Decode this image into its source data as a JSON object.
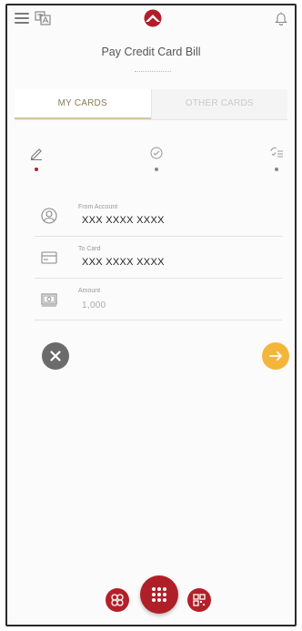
{
  "header": {
    "title": "Pay Credit Card Bill",
    "icons": [
      "menu-icon",
      "language-icon",
      "logo",
      "bell-icon"
    ]
  },
  "tabs": [
    {
      "label": "MY CARDS",
      "active": true
    },
    {
      "label": "OTHER CARDS",
      "active": false
    }
  ],
  "steps": [
    {
      "icon": "edit-pencil-icon",
      "state": "current"
    },
    {
      "icon": "verify-check-icon",
      "state": "pending"
    },
    {
      "icon": "confirm-list-icon",
      "state": "pending"
    }
  ],
  "form": {
    "from_account": {
      "label": "From Account",
      "value": "XXX XXXX XXXX"
    },
    "to_card": {
      "label": "To Card",
      "value": "XXX XXXX XXXX"
    },
    "amount": {
      "label": "Amount",
      "placeholder": "1,000"
    }
  },
  "actions": {
    "cancel_icon": "close-icon",
    "next_icon": "arrow-right-icon"
  },
  "bottom_nav": [
    "rewards-icon",
    "menu-grid-icon",
    "qr-icon"
  ],
  "colors": {
    "brand_red": "#b01f28",
    "accent_gold": "#d5c5a1",
    "next_orange": "#f4b63a",
    "cancel_gray": "#6b6b6b"
  }
}
